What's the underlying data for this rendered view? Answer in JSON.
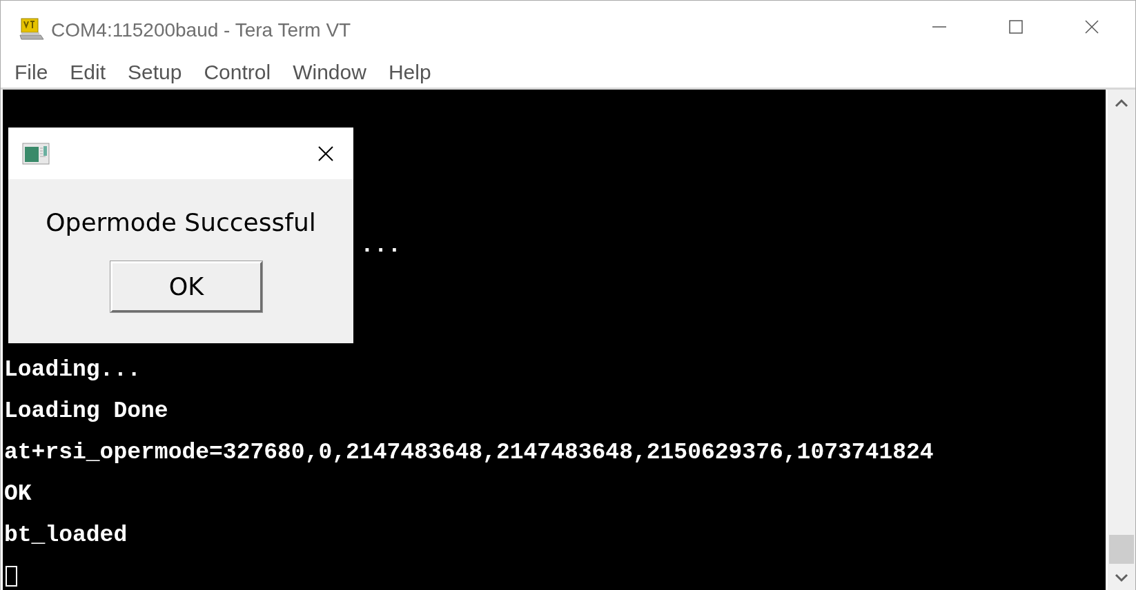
{
  "window": {
    "title": "COM4:115200baud - Tera Term VT"
  },
  "menu": [
    {
      "label": "File"
    },
    {
      "label": "Edit"
    },
    {
      "label": "Setup"
    },
    {
      "label": "Control"
    },
    {
      "label": "Window"
    },
    {
      "label": "Help"
    }
  ],
  "terminal": {
    "lines": [
      {
        "kind": "blank"
      },
      {
        "kind": "blank"
      },
      {
        "kind": "blank"
      },
      {
        "kind": "partial",
        "text": "..."
      },
      {
        "kind": "blank"
      },
      {
        "kind": "blank"
      },
      {
        "kind": "text",
        "text": "Loading..."
      },
      {
        "kind": "text",
        "text": "Loading Done"
      },
      {
        "kind": "text",
        "text": "at+rsi_opermode=327680,0,2147483648,2147483648,2150629376,1073741824"
      },
      {
        "kind": "text",
        "text": "OK"
      },
      {
        "kind": "text",
        "text": "bt_loaded"
      },
      {
        "kind": "cursor"
      }
    ]
  },
  "dialog": {
    "message": "Opermode Successful",
    "button": "OK"
  }
}
